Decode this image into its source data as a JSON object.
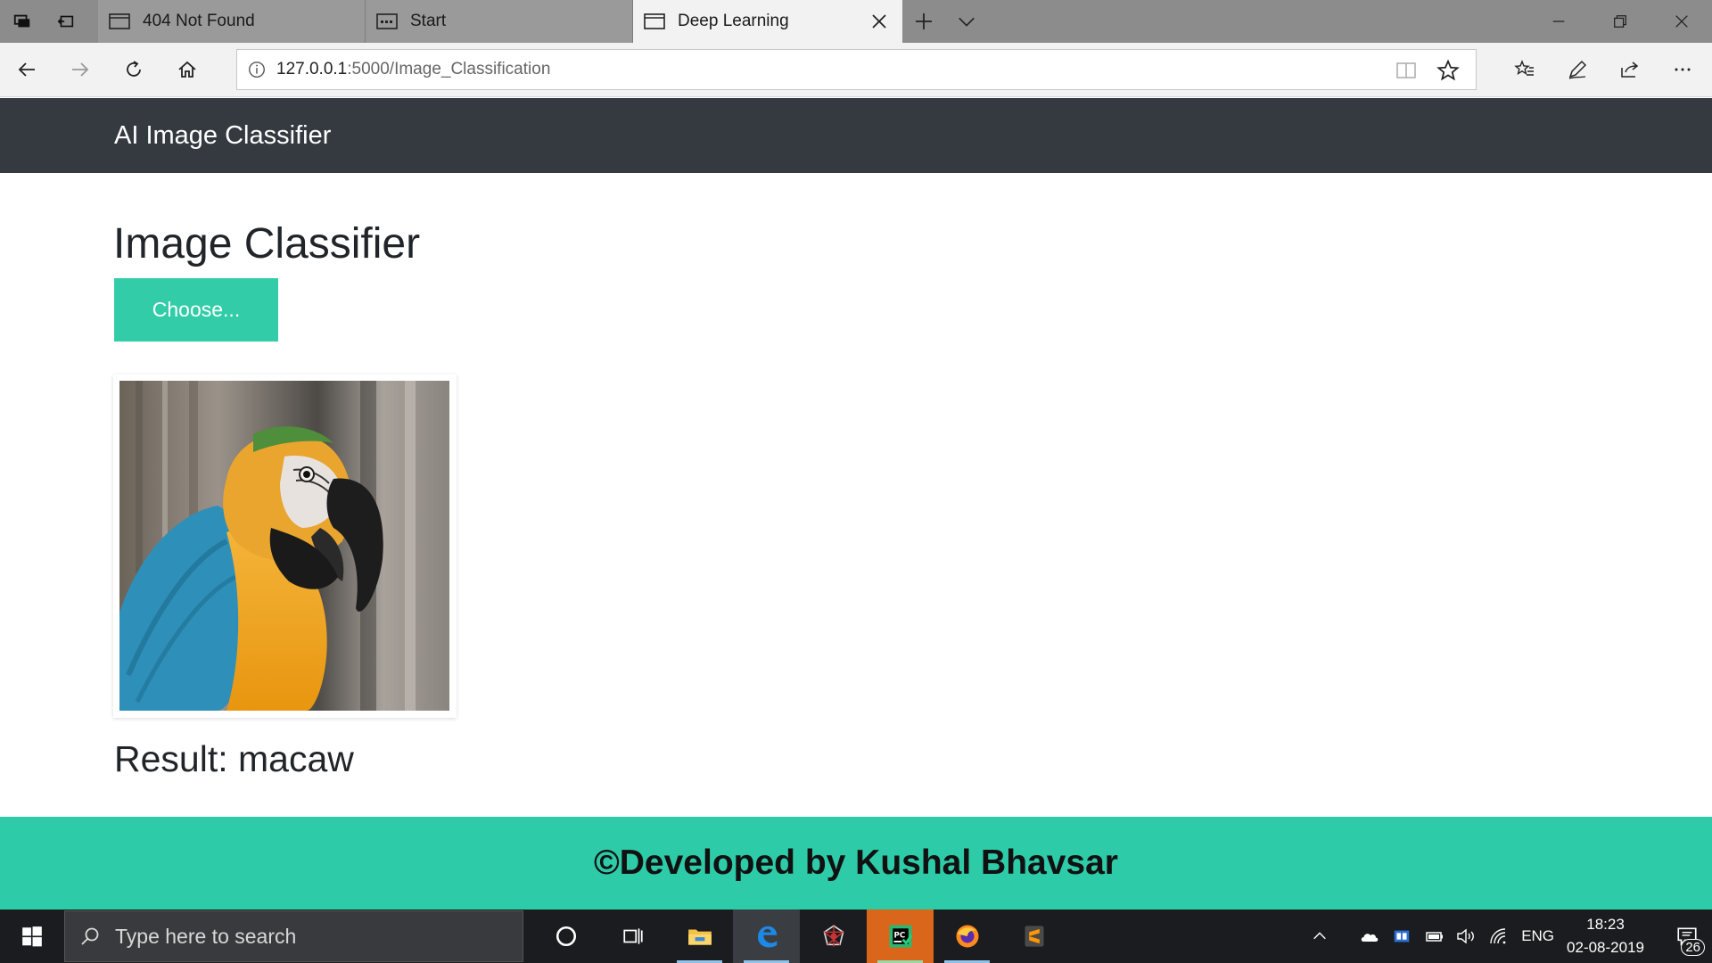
{
  "browser": {
    "tabs": [
      {
        "title": "404 Not Found",
        "icon": "page-icon",
        "active": false
      },
      {
        "title": "Start",
        "icon": "start-page-icon",
        "active": false
      },
      {
        "title": "Deep Learning",
        "icon": "page-icon",
        "active": true
      }
    ],
    "url_host": "127.0.0.1",
    "url_rest": ":5000/Image_Classification"
  },
  "site": {
    "brand": "AI Image Classifier",
    "title": "Image Classifier",
    "choose_label": "Choose...",
    "result": "Result: macaw",
    "footer": "©Developed by Kushal Bhavsar"
  },
  "taskbar": {
    "search_placeholder": "Type here to search",
    "language": "ENG",
    "time": "18:23",
    "date": "02-08-2019",
    "notifications": "26"
  },
  "colors": {
    "header_bg": "#343a40",
    "accent": "#32cda8",
    "footer_bg": "#2ecba9"
  }
}
